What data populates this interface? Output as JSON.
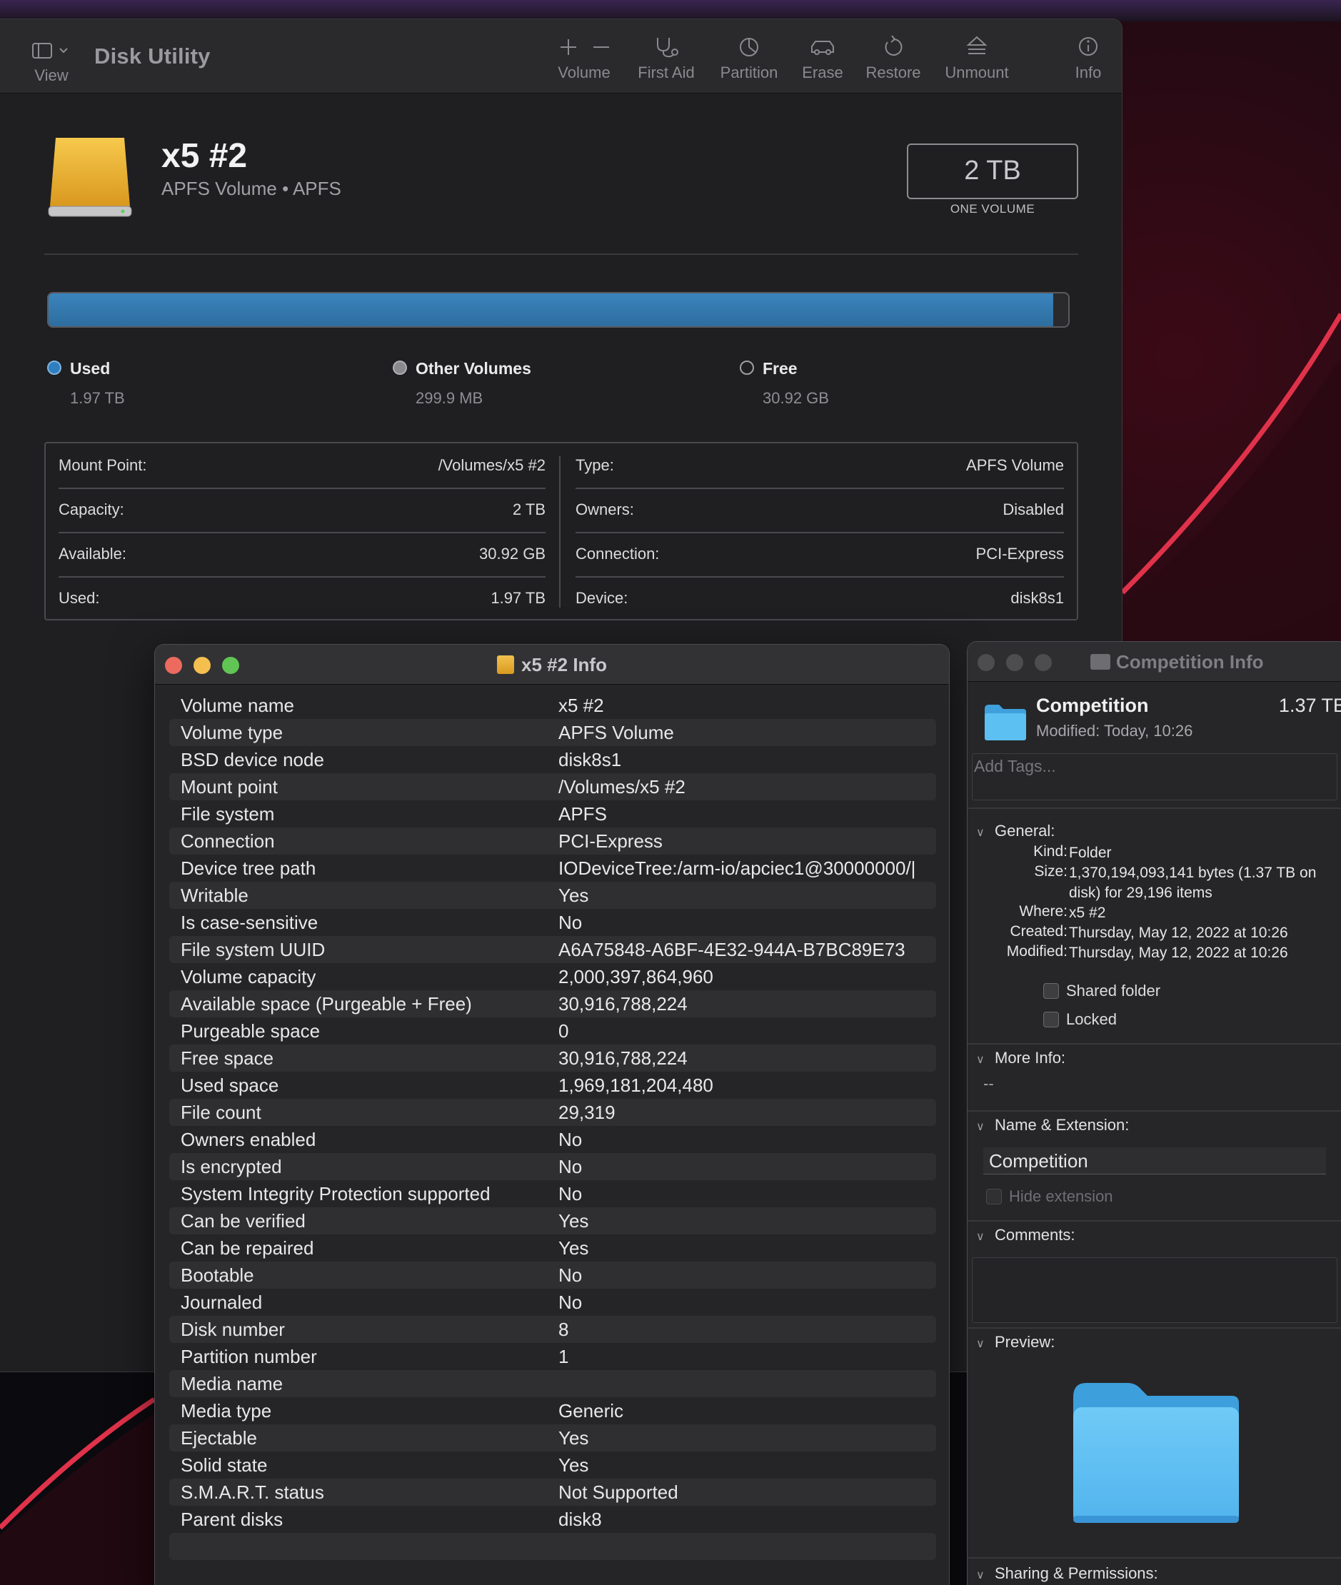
{
  "app": {
    "title": "Disk Utility",
    "view_label": "View"
  },
  "toolbar": [
    {
      "id": "volume",
      "label": "Volume",
      "icon": "plus-minus-icon"
    },
    {
      "id": "first-aid",
      "label": "First Aid",
      "icon": "stethoscope-icon"
    },
    {
      "id": "partition",
      "label": "Partition",
      "icon": "pie-icon"
    },
    {
      "id": "erase",
      "label": "Erase",
      "icon": "car-icon"
    },
    {
      "id": "restore",
      "label": "Restore",
      "icon": "restore-icon"
    },
    {
      "id": "unmount",
      "label": "Unmount",
      "icon": "eject-icon"
    },
    {
      "id": "info",
      "label": "Info",
      "icon": "info-icon"
    }
  ],
  "volume": {
    "name": "x5 #2",
    "subtitle": "APFS Volume • APFS",
    "size": "2 TB",
    "size_caption": "ONE VOLUME",
    "used_fraction": 0.985
  },
  "legend": [
    {
      "name": "Used",
      "value": "1.97 TB",
      "color": "#2f7fc0"
    },
    {
      "name": "Other Volumes",
      "value": "299.9 MB",
      "color": "#8a8a8e"
    },
    {
      "name": "Free",
      "value": "30.92 GB",
      "color": "#1f1f21"
    }
  ],
  "info_table": {
    "left": [
      {
        "key": "Mount Point:",
        "value": "/Volumes/x5 #2"
      },
      {
        "key": "Capacity:",
        "value": "2 TB"
      },
      {
        "key": "Available:",
        "value": "30.92 GB"
      },
      {
        "key": "Used:",
        "value": "1.97 TB"
      }
    ],
    "right": [
      {
        "key": "Type:",
        "value": "APFS Volume"
      },
      {
        "key": "Owners:",
        "value": "Disabled"
      },
      {
        "key": "Connection:",
        "value": "PCI-Express"
      },
      {
        "key": "Device:",
        "value": "disk8s1"
      }
    ]
  },
  "info_window": {
    "title": "x5 #2 Info",
    "rows": [
      {
        "key": "Volume name",
        "value": "x5 #2"
      },
      {
        "key": "Volume type",
        "value": "APFS Volume"
      },
      {
        "key": "BSD device node",
        "value": "disk8s1"
      },
      {
        "key": "Mount point",
        "value": "/Volumes/x5 #2"
      },
      {
        "key": "File system",
        "value": "APFS"
      },
      {
        "key": "Connection",
        "value": "PCI-Express"
      },
      {
        "key": "Device tree path",
        "value": "IODeviceTree:/arm-io/apciec1@30000000/|"
      },
      {
        "key": "Writable",
        "value": "Yes"
      },
      {
        "key": "Is case-sensitive",
        "value": "No"
      },
      {
        "key": "File system UUID",
        "value": "A6A75848-A6BF-4E32-944A-B7BC89E73"
      },
      {
        "key": "Volume capacity",
        "value": "2,000,397,864,960"
      },
      {
        "key": "Available space (Purgeable + Free)",
        "value": "30,916,788,224"
      },
      {
        "key": "Purgeable space",
        "value": "0"
      },
      {
        "key": "Free space",
        "value": "30,916,788,224"
      },
      {
        "key": "Used space",
        "value": "1,969,181,204,480"
      },
      {
        "key": "File count",
        "value": "29,319"
      },
      {
        "key": "Owners enabled",
        "value": "No"
      },
      {
        "key": "Is encrypted",
        "value": "No"
      },
      {
        "key": "System Integrity Protection supported",
        "value": "No"
      },
      {
        "key": "Can be verified",
        "value": "Yes"
      },
      {
        "key": "Can be repaired",
        "value": "Yes"
      },
      {
        "key": "Bootable",
        "value": "No"
      },
      {
        "key": "Journaled",
        "value": "No"
      },
      {
        "key": "Disk number",
        "value": "8"
      },
      {
        "key": "Partition number",
        "value": "1"
      },
      {
        "key": "Media name",
        "value": ""
      },
      {
        "key": "Media type",
        "value": "Generic"
      },
      {
        "key": "Ejectable",
        "value": "Yes"
      },
      {
        "key": "Solid state",
        "value": "Yes"
      },
      {
        "key": "S.M.A.R.T. status",
        "value": "Not Supported"
      },
      {
        "key": "Parent disks",
        "value": "disk8"
      },
      {
        "key": "",
        "value": ""
      }
    ]
  },
  "competition_window": {
    "title": "Competition Info",
    "name": "Competition",
    "size": "1.37 TB",
    "modified_label": "Modified:",
    "modified_value": "Today, 10:26",
    "tags_placeholder": "Add Tags...",
    "general_label": "General:",
    "general": [
      {
        "key": "Kind:",
        "value": "Folder"
      },
      {
        "key": "Size:",
        "value": "1,370,194,093,141 bytes (1.37 TB on disk) for 29,196 items"
      },
      {
        "key": "Where:",
        "value": "x5 #2"
      },
      {
        "key": "Created:",
        "value": "Thursday, May 12, 2022 at 10:26"
      },
      {
        "key": "Modified:",
        "value": "Thursday, May 12, 2022 at 10:26"
      }
    ],
    "shared_folder_label": "Shared folder",
    "locked_label": "Locked",
    "more_info_label": "More Info:",
    "more_info_value": "--",
    "name_ext_label": "Name & Extension:",
    "name_ext_value": "Competition",
    "hide_extension_label": "Hide extension",
    "comments_label": "Comments:",
    "preview_label": "Preview:",
    "sharing_label": "Sharing & Permissions:"
  },
  "colors": {
    "accent_blue": "#2f7fc0",
    "folder_blue": "#4fb3ee",
    "close": "#ed6a5e",
    "minimize": "#f5bf4f",
    "zoom": "#61c554"
  }
}
